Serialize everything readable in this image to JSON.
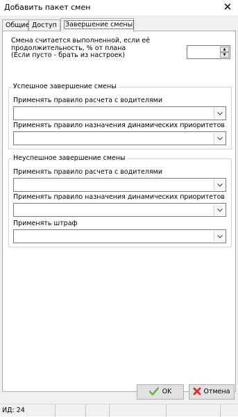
{
  "window": {
    "title": "Добавить пакет смен",
    "close_label": "✕"
  },
  "tabs": [
    {
      "label": "Общие",
      "active": false
    },
    {
      "label": "Доступ",
      "active": false
    },
    {
      "label": "Завершение смены",
      "active": true
    }
  ],
  "plan": {
    "label_line1": "Смена считается выполненной, если её",
    "label_line2": "продолжительность, % от плана",
    "label_line3": "(Если пусто - брать из настроек)",
    "value": ""
  },
  "success_group": {
    "title": "Успешное завершение смены",
    "driver_rule_label": "Применять правило расчета с водителями",
    "driver_rule_value": "",
    "priority_rule_label": "Применять правило назначения динамических приоритетов",
    "priority_rule_value": ""
  },
  "failure_group": {
    "title": "Неуспешное завершение смены",
    "driver_rule_label": "Применять правило расчета с водителями",
    "driver_rule_value": "",
    "priority_rule_label": "Применять правило назначения динамических приоритетов",
    "priority_rule_value": "",
    "penalty_label": "Применять штраф",
    "penalty_value": ""
  },
  "buttons": {
    "ok_label": "OK",
    "cancel_label": "Отмена"
  },
  "status": {
    "id_text": "ИД: 24"
  },
  "colors": {
    "ok_check": "#6ab04c",
    "cancel_x": "#d9342b"
  }
}
